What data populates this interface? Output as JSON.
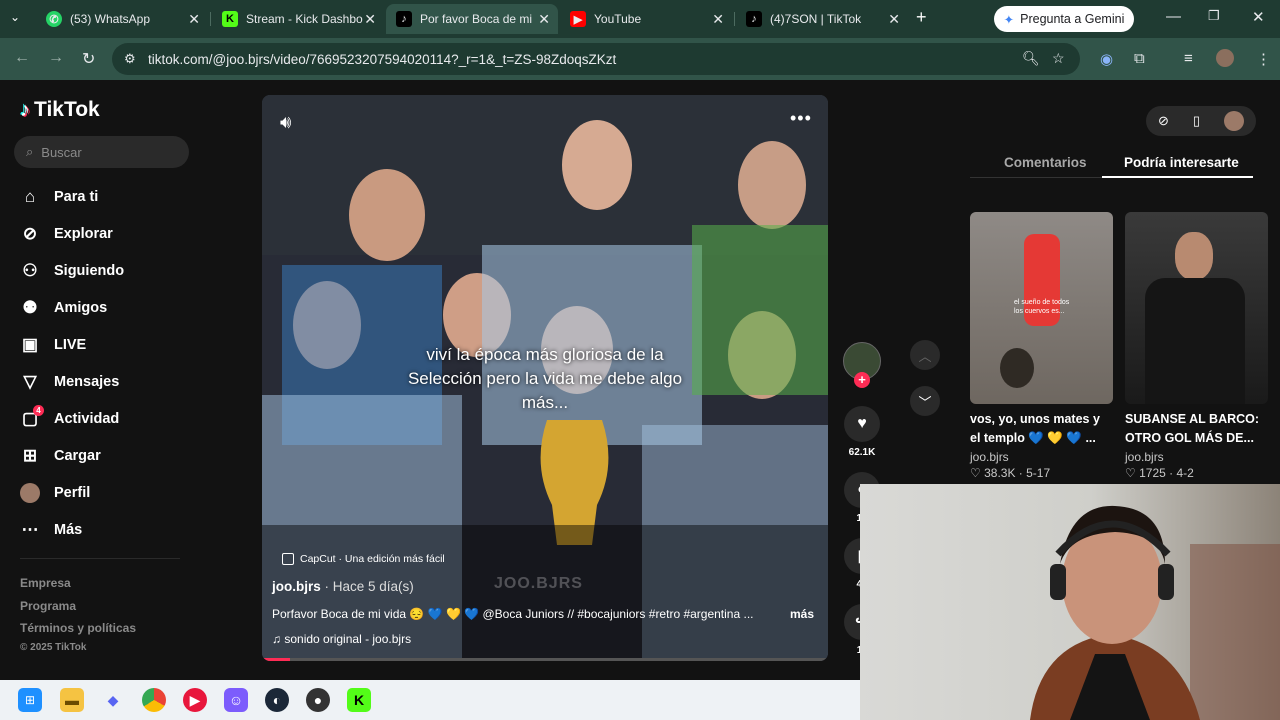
{
  "browser": {
    "tabs": [
      {
        "title": "(53) WhatsApp",
        "icon": "whatsapp-icon",
        "color": "#25d366"
      },
      {
        "title": "Stream - Kick Dashbo",
        "icon": "kick-icon",
        "color": "#53fc18"
      },
      {
        "title": "Por favor Boca de mi",
        "icon": "tiktok-icon",
        "color": "#ffffff",
        "active": true
      },
      {
        "title": "YouTube",
        "icon": "youtube-icon",
        "color": "#ff0000"
      },
      {
        "title": "(4)7SON | TikTok",
        "icon": "tiktok-icon",
        "color": "#ffffff"
      }
    ],
    "gemini_label": "Pregunta a Gemini",
    "url": "tiktok.com/@joo.bjrs/video/7669523207594020114?_r=1&_t=ZS-98ZdoqsZKzt",
    "accent": "#315449"
  },
  "sidebar": {
    "logo": "TikTok",
    "search_placeholder": "Buscar",
    "items": [
      {
        "label": "Para ti",
        "icon": "home-icon"
      },
      {
        "label": "Explorar",
        "icon": "compass-icon"
      },
      {
        "label": "Siguiendo",
        "icon": "following-icon"
      },
      {
        "label": "Amigos",
        "icon": "friends-icon"
      },
      {
        "label": "LIVE",
        "icon": "live-icon"
      },
      {
        "label": "Mensajes",
        "icon": "messages-icon"
      },
      {
        "label": "Actividad",
        "icon": "activity-icon",
        "badge": "4"
      },
      {
        "label": "Cargar",
        "icon": "upload-icon"
      },
      {
        "label": "Perfil",
        "icon": "avatar"
      },
      {
        "label": "Más",
        "icon": "more-icon"
      }
    ],
    "footer": [
      "Empresa",
      "Programa",
      "Términos y políticas",
      "© 2025 TikTok"
    ]
  },
  "video": {
    "overlay_caption": "viví la época más gloriosa de la Selección pero la vida me debe algo más...",
    "capcut": "CapCut · Una edición más fácil",
    "author": "joo.bjrs",
    "time_ago": " · Hace 5 día(s)",
    "description": "Porfavor Boca de mi vida 😔 💙 💛 💙 @Boca Juniors // #bocajuniors #retro #argentina ...",
    "more": "más",
    "sound": "sonido original - joo.bjrs",
    "watermark": "JOO.BJRS",
    "progress": 0.05
  },
  "actions": {
    "likes": "62.1K",
    "comments": "15",
    "saves": "41",
    "shares": "11"
  },
  "right_panel": {
    "tabs": [
      "Comentarios",
      "Podría interesarte"
    ],
    "cards": [
      {
        "title": "vos, yo, unos mates y el templo 💙 💛 💙 ...",
        "user": "joo.bjrs",
        "stats": "♡ 38.3K · 5-17",
        "overlay": "el sueño de todos los cuervos es..."
      },
      {
        "title": "SUBANSE AL BARCO: OTRO GOL MÁS DE...",
        "user": "joo.bjrs",
        "stats": "♡ 1725 · 4-2",
        "overlay": ""
      }
    ]
  }
}
